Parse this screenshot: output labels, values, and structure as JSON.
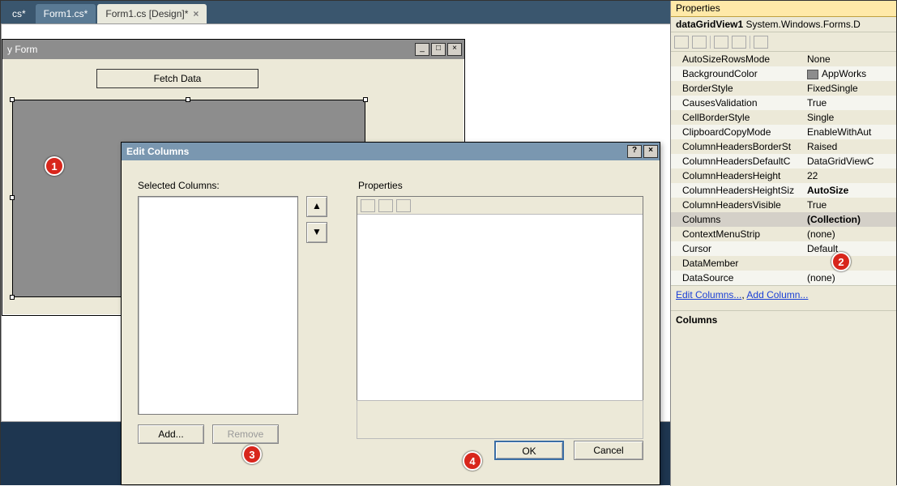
{
  "tabs": {
    "t0": "cs*",
    "t1": "Form1.cs*",
    "t2": "Form1.cs [Design]*"
  },
  "form": {
    "title": "y Form",
    "min": "_",
    "max": "□",
    "close": "×",
    "fetch": "Fetch Data"
  },
  "dialog": {
    "title": "Edit Columns",
    "help": "?",
    "close": "×",
    "selcols": "Selected Columns:",
    "props": "Properties",
    "up": "▲",
    "down": "▼",
    "add": "Add...",
    "remove": "Remove",
    "ok": "OK",
    "cancel": "Cancel"
  },
  "pp": {
    "title": "Properties",
    "obj_name": "dataGridView1",
    "obj_type": "System.Windows.Forms.D",
    "rows": [
      {
        "n": "AutoSizeRowsMode",
        "v": "None"
      },
      {
        "n": "BackgroundColor",
        "v": "AppWorks",
        "swatch": true
      },
      {
        "n": "BorderStyle",
        "v": "FixedSingle"
      },
      {
        "n": "CausesValidation",
        "v": "True"
      },
      {
        "n": "CellBorderStyle",
        "v": "Single"
      },
      {
        "n": "ClipboardCopyMode",
        "v": "EnableWithAut"
      },
      {
        "n": "ColumnHeadersBorderSt",
        "v": "Raised"
      },
      {
        "n": "ColumnHeadersDefaultC",
        "v": "DataGridViewC"
      },
      {
        "n": "ColumnHeadersHeight",
        "v": "22"
      },
      {
        "n": "ColumnHeadersHeightSiz",
        "v": "AutoSize",
        "bold": true
      },
      {
        "n": "ColumnHeadersVisible",
        "v": "True"
      },
      {
        "n": "Columns",
        "v": "(Collection)",
        "sel": true,
        "bold": true
      },
      {
        "n": "ContextMenuStrip",
        "v": "(none)"
      },
      {
        "n": "Cursor",
        "v": "Default"
      },
      {
        "n": "DataMember",
        "v": ""
      },
      {
        "n": "DataSource",
        "v": "(none)"
      }
    ],
    "link1": "Edit Columns...",
    "link2": "Add Column...",
    "desc_h": "Columns",
    "desc_b": ""
  },
  "badges": {
    "b1": "1",
    "b2": "2",
    "b3": "3",
    "b4": "4"
  }
}
